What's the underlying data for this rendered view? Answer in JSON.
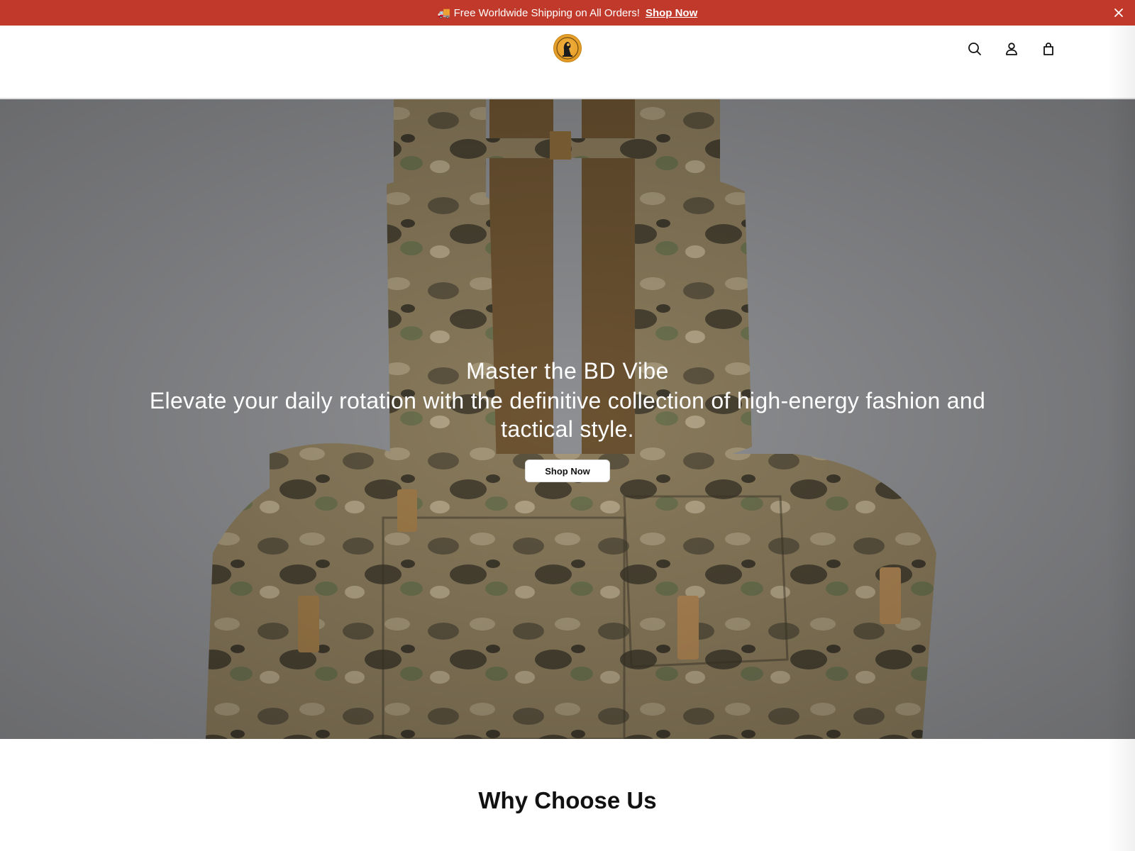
{
  "announcement": {
    "icon": "truck-icon",
    "text": "🚚 Free Worldwide Shipping on All Orders!",
    "link_label": "Shop Now"
  },
  "header": {
    "logo": "brand-logo",
    "icons": [
      "search-icon",
      "account-icon",
      "cart-icon"
    ]
  },
  "hero": {
    "title": "Master the BD Vibe",
    "subtitle": "Elevate your daily rotation with the definitive collection of high-energy fashion and tactical style.",
    "button_label": "Shop Now"
  },
  "section": {
    "heading": "Why Choose Us"
  },
  "colors": {
    "announcement_bg": "#c0392b",
    "hero_bg": "#8c8c8e"
  }
}
